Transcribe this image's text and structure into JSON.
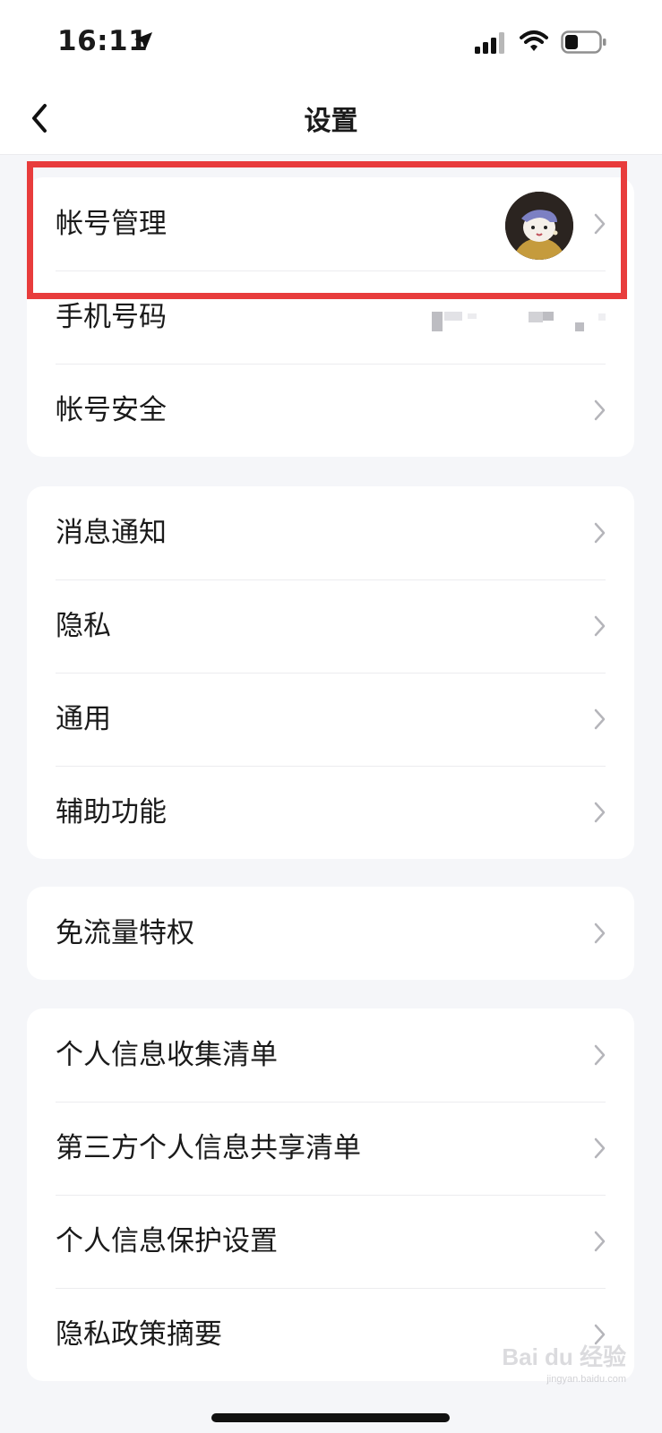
{
  "status_bar": {
    "time": "16:11",
    "icons": [
      "location-arrow-icon",
      "signal-icon",
      "wifi-icon",
      "battery-icon"
    ]
  },
  "nav": {
    "title": "设置",
    "back_icon": "chevron-left-icon"
  },
  "groups": [
    {
      "items": [
        {
          "label": "帐号管理",
          "trailing": "avatar"
        },
        {
          "label": "手机号码",
          "trailing": "masked-value"
        },
        {
          "label": "帐号安全",
          "trailing": "chevron"
        }
      ]
    },
    {
      "items": [
        {
          "label": "消息通知",
          "trailing": "chevron"
        },
        {
          "label": "隐私",
          "trailing": "chevron"
        },
        {
          "label": "通用",
          "trailing": "chevron"
        },
        {
          "label": "辅助功能",
          "trailing": "chevron"
        }
      ]
    },
    {
      "items": [
        {
          "label": "免流量特权",
          "trailing": "chevron"
        }
      ]
    },
    {
      "items": [
        {
          "label": "个人信息收集清单",
          "trailing": "chevron"
        },
        {
          "label": "第三方个人信息共享清单",
          "trailing": "chevron"
        },
        {
          "label": "个人信息保护设置",
          "trailing": "chevron"
        },
        {
          "label": "隐私政策摘要",
          "trailing": "chevron"
        }
      ]
    }
  ],
  "watermark": {
    "text": "Bai du 经验",
    "sub": "jingyan.baidu.com"
  },
  "colors": {
    "background": "#f5f6f9",
    "card": "#ffffff",
    "highlight": "#e83c3c",
    "chevron": "#b5b5ba"
  }
}
